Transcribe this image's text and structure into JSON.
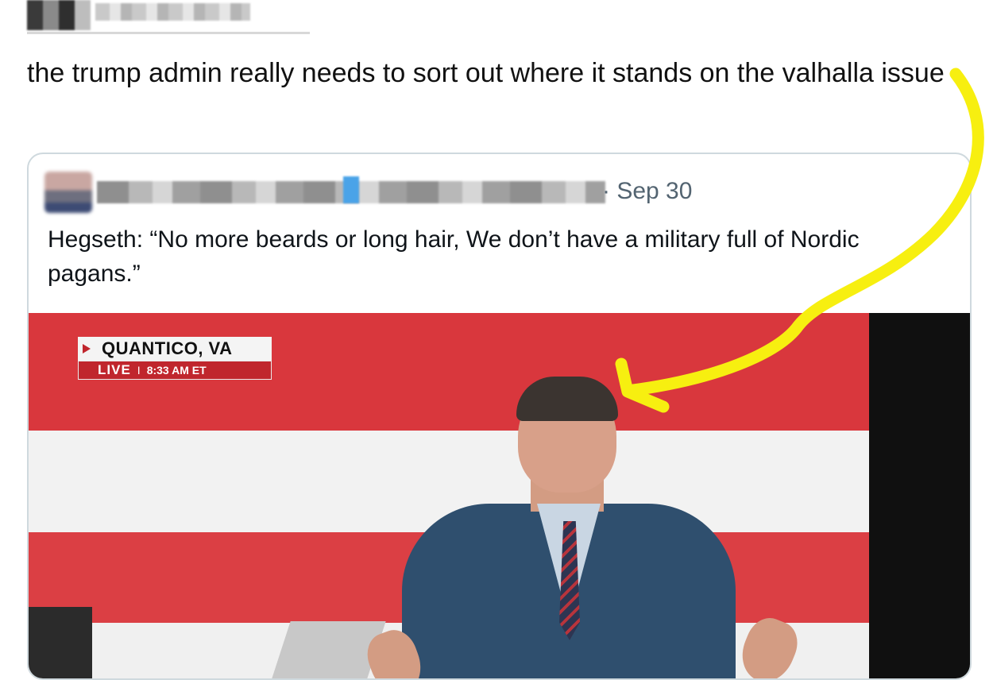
{
  "tweet": {
    "text": "the trump admin really needs to sort out where it stands on the valhalla issue"
  },
  "quoted_tweet": {
    "date": "· Sep 30",
    "text": "Hegseth: “No more beards or long hair, We don’t have a military full of Nordic pagans.”"
  },
  "video_chyron": {
    "location": "QUANTICO, VA",
    "live_label": "LIVE",
    "separator": "I",
    "time": "8:33 AM ET"
  },
  "colors": {
    "annotation": "#f7ef10",
    "flag_red": "#d9373d",
    "chyron_red": "#c0262d",
    "date_gray": "#536471"
  },
  "icons": {
    "chyron_arrow": "play-triangle-icon"
  }
}
